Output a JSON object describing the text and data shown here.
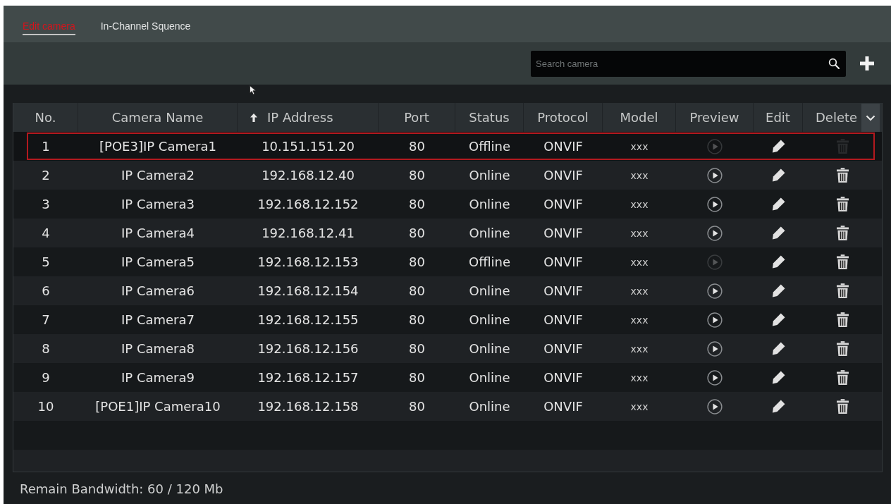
{
  "tabs": [
    {
      "label": "Edit camera",
      "selected": true
    },
    {
      "label": "In-Channel Squence",
      "selected": false
    }
  ],
  "search": {
    "placeholder": "Search camera"
  },
  "table": {
    "columns": [
      {
        "label": "No.",
        "sorted": false,
        "menu": false
      },
      {
        "label": "Camera Name",
        "sorted": false,
        "menu": false
      },
      {
        "label": "IP Address",
        "sorted": true,
        "menu": false
      },
      {
        "label": "Port",
        "sorted": false,
        "menu": false
      },
      {
        "label": "Status",
        "sorted": false,
        "menu": false
      },
      {
        "label": "Protocol",
        "sorted": false,
        "menu": false
      },
      {
        "label": "Model",
        "sorted": false,
        "menu": false
      },
      {
        "label": "Preview",
        "sorted": false,
        "menu": false
      },
      {
        "label": "Edit",
        "sorted": false,
        "menu": false
      },
      {
        "label": "Delete",
        "sorted": false,
        "menu": true
      }
    ],
    "rows": [
      {
        "no": "1",
        "camera_name": "[POE3]IP Camera1",
        "ip_address": "10.151.151.20",
        "port": "80",
        "status": "Offline",
        "protocol": "ONVIF",
        "model": "xxx",
        "selected": true,
        "preview_disabled": true,
        "delete_disabled": true
      },
      {
        "no": "2",
        "camera_name": "IP Camera2",
        "ip_address": "192.168.12.40",
        "port": "80",
        "status": "Online",
        "protocol": "ONVIF",
        "model": "xxx",
        "selected": false,
        "preview_disabled": false,
        "delete_disabled": false
      },
      {
        "no": "3",
        "camera_name": "IP Camera3",
        "ip_address": "192.168.12.152",
        "port": "80",
        "status": "Online",
        "protocol": "ONVIF",
        "model": "xxx",
        "selected": false,
        "preview_disabled": false,
        "delete_disabled": false
      },
      {
        "no": "4",
        "camera_name": "IP Camera4",
        "ip_address": "192.168.12.41",
        "port": "80",
        "status": "Online",
        "protocol": "ONVIF",
        "model": "xxx",
        "selected": false,
        "preview_disabled": false,
        "delete_disabled": false
      },
      {
        "no": "5",
        "camera_name": "IP Camera5",
        "ip_address": "192.168.12.153",
        "port": "80",
        "status": "Offline",
        "protocol": "ONVIF",
        "model": "xxx",
        "selected": false,
        "preview_disabled": true,
        "delete_disabled": false
      },
      {
        "no": "6",
        "camera_name": "IP Camera6",
        "ip_address": "192.168.12.154",
        "port": "80",
        "status": "Online",
        "protocol": "ONVIF",
        "model": "xxx",
        "selected": false,
        "preview_disabled": false,
        "delete_disabled": false
      },
      {
        "no": "7",
        "camera_name": "IP Camera7",
        "ip_address": "192.168.12.155",
        "port": "80",
        "status": "Online",
        "protocol": "ONVIF",
        "model": "xxx",
        "selected": false,
        "preview_disabled": false,
        "delete_disabled": false
      },
      {
        "no": "8",
        "camera_name": "IP Camera8",
        "ip_address": "192.168.12.156",
        "port": "80",
        "status": "Online",
        "protocol": "ONVIF",
        "model": "xxx",
        "selected": false,
        "preview_disabled": false,
        "delete_disabled": false
      },
      {
        "no": "9",
        "camera_name": "IP Camera9",
        "ip_address": "192.168.12.157",
        "port": "80",
        "status": "Online",
        "protocol": "ONVIF",
        "model": "xxx",
        "selected": false,
        "preview_disabled": false,
        "delete_disabled": false
      },
      {
        "no": "10",
        "camera_name": "[POE1]IP Camera10",
        "ip_address": "192.168.12.158",
        "port": "80",
        "status": "Online",
        "protocol": "ONVIF",
        "model": "xxx",
        "selected": false,
        "preview_disabled": false,
        "delete_disabled": false
      }
    ]
  },
  "status_bar": {
    "text": "Remain Bandwidth: 60 / 120 Mb"
  }
}
